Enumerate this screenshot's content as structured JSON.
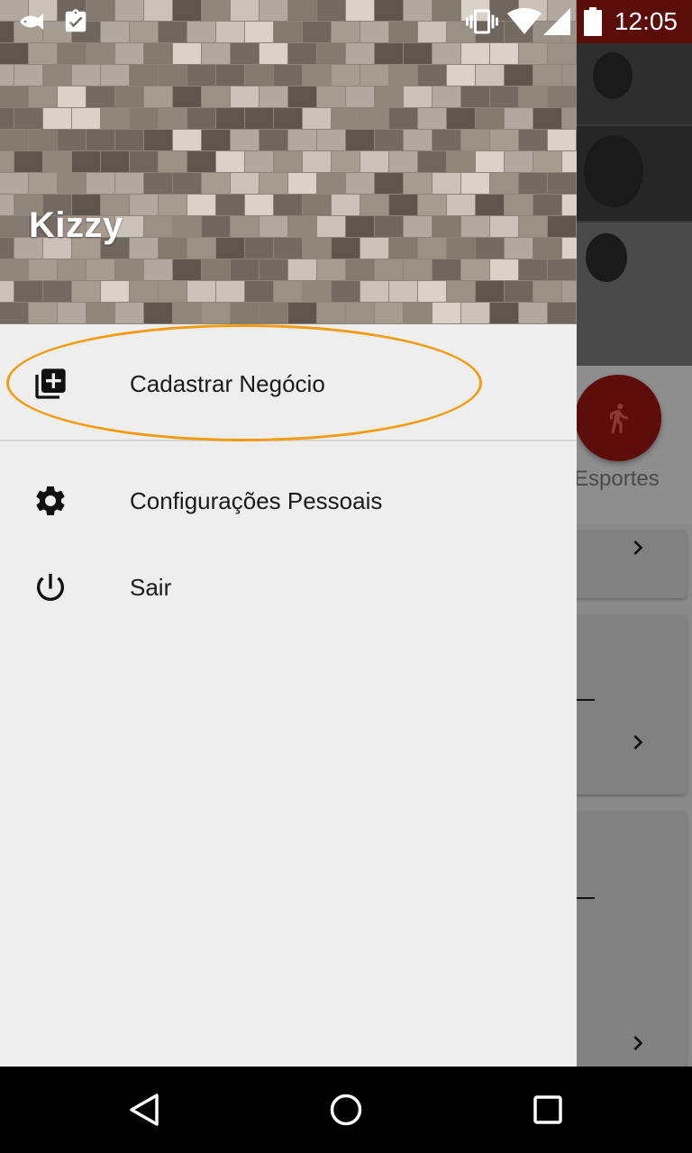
{
  "status_bar": {
    "time": "12:05",
    "left_icons": [
      "fish-icon",
      "clipboard-check-icon"
    ],
    "right_icons": [
      "vibrate-icon",
      "wifi-icon",
      "signal-icon",
      "battery-icon"
    ]
  },
  "drawer": {
    "header_title": "Kizzy",
    "items": [
      {
        "label": "Cadastrar Negócio",
        "icon": "add-library-icon",
        "highlighted": true
      },
      {
        "label": "Configurações Pessoais",
        "icon": "gear-icon"
      },
      {
        "label": "Sair",
        "icon": "power-icon"
      }
    ],
    "highlight_color": "#f39c12"
  },
  "background_screen": {
    "category_label": "Esportes",
    "fab_icon": "running-person-icon",
    "fab_color": "#5d0d0a"
  },
  "nav_bar": {
    "icons": [
      "back-icon",
      "home-icon",
      "recents-icon"
    ]
  }
}
